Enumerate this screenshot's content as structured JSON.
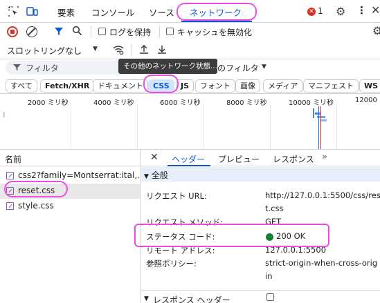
{
  "tabs": {
    "elements": "要素",
    "console": "コンソール",
    "sources": "ソース",
    "network": "ネットワーク",
    "error_count": "1"
  },
  "toolbar": {
    "preserve_log": "ログを保持",
    "disable_cache": "キャッシュを無効化",
    "throttling": "スロットリングなし"
  },
  "filter": {
    "label": "フィルタ",
    "tooltip": "その他のネットワーク状態...",
    "more_filters": "のフィルタ"
  },
  "chips": [
    "すべて",
    "Fetch/XHR",
    "ドキュメント",
    "CSS",
    "JS",
    "フォント",
    "画像",
    "メディア",
    "マニフェスト",
    "WS"
  ],
  "overview": {
    "ticks": [
      "2000 ミリ秒",
      "4000 ミリ秒",
      "6000 ミリ秒",
      "8000 ミリ秒",
      "10000 ミリ秒",
      "12000"
    ]
  },
  "requests": {
    "header": "名前",
    "items": [
      "css2?family=Montserrat:ital,...",
      "reset.css",
      "style.css"
    ]
  },
  "detail": {
    "tabs": {
      "headers": "ヘッダー",
      "preview": "プレビュー",
      "response": "レスポンス"
    },
    "section_general": "全般",
    "section_response_headers": "レスポンス ヘッダー",
    "fields": {
      "request_url_label": "リクエスト URL:",
      "request_url_value_1": "http://127.0.0.1:5500/css/rese",
      "request_url_value_2": "t.css",
      "request_method_label": "リクエスト メソッド:",
      "request_method_value": "GET",
      "status_code_label": "ステータス コード:",
      "status_code_value": "200 OK",
      "remote_address_label": "リモート アドレス:",
      "remote_address_value": "127.0.0.1:5500",
      "referrer_policy_label": "参照ポリシー:",
      "referrer_policy_value_1": "strict-origin-when-cross-orig",
      "referrer_policy_value_2": "in"
    }
  },
  "colors": {
    "accent": "#0b57d0",
    "record_red": "#d93025",
    "status_green": "#188038",
    "annotation": "#ea4ee3"
  }
}
